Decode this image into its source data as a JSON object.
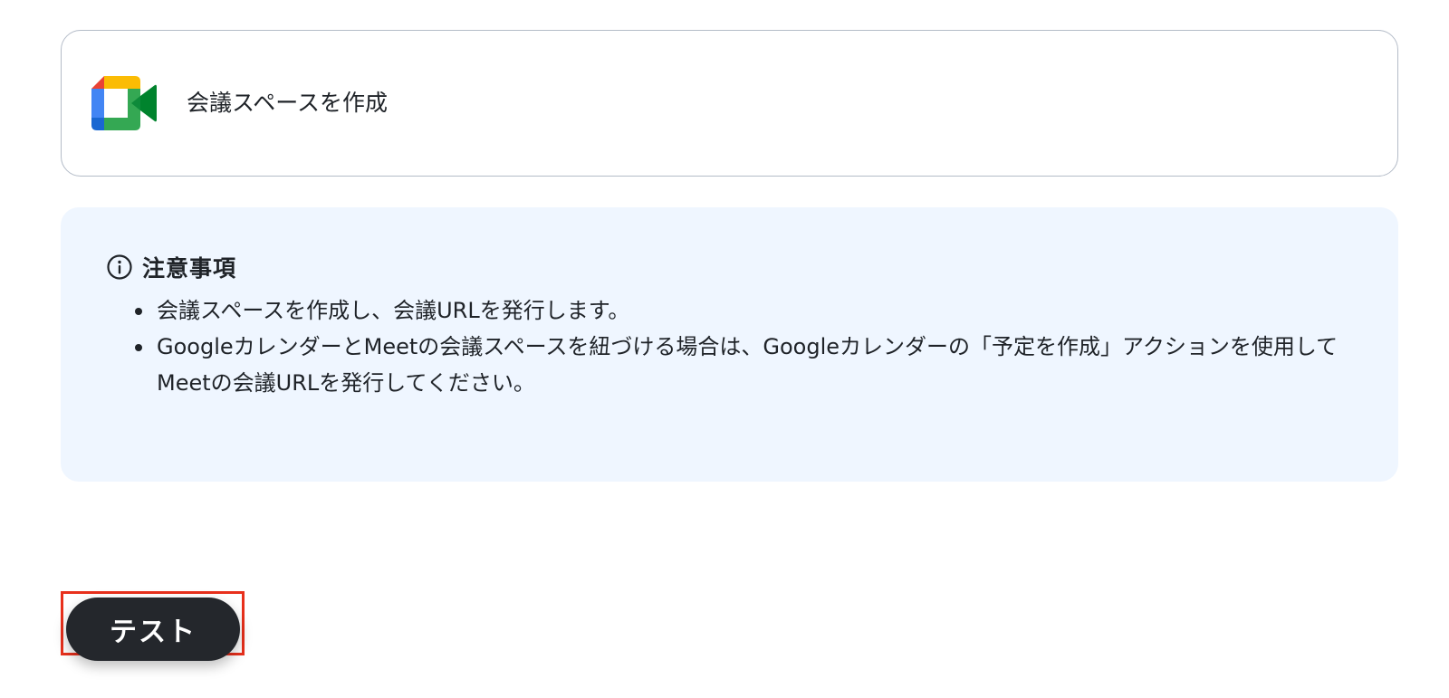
{
  "action_card": {
    "app_icon": "google-meet-icon",
    "title": "会議スペースを作成"
  },
  "notes": {
    "icon": "info-icon",
    "title": "注意事項",
    "items": [
      "会議スペースを作成し、会議URLを発行します。",
      "GoogleカレンダーとMeetの会議スペースを紐づける場合は、Googleカレンダーの「予定を作成」アクションを使用してMeetの会議URLを発行してください。"
    ]
  },
  "test_button": {
    "label": "テスト"
  },
  "colors": {
    "notes_background": "#eff6ff",
    "button_background": "#24272c",
    "highlight_border": "#e8301c",
    "card_border": "#b4bcc8"
  }
}
